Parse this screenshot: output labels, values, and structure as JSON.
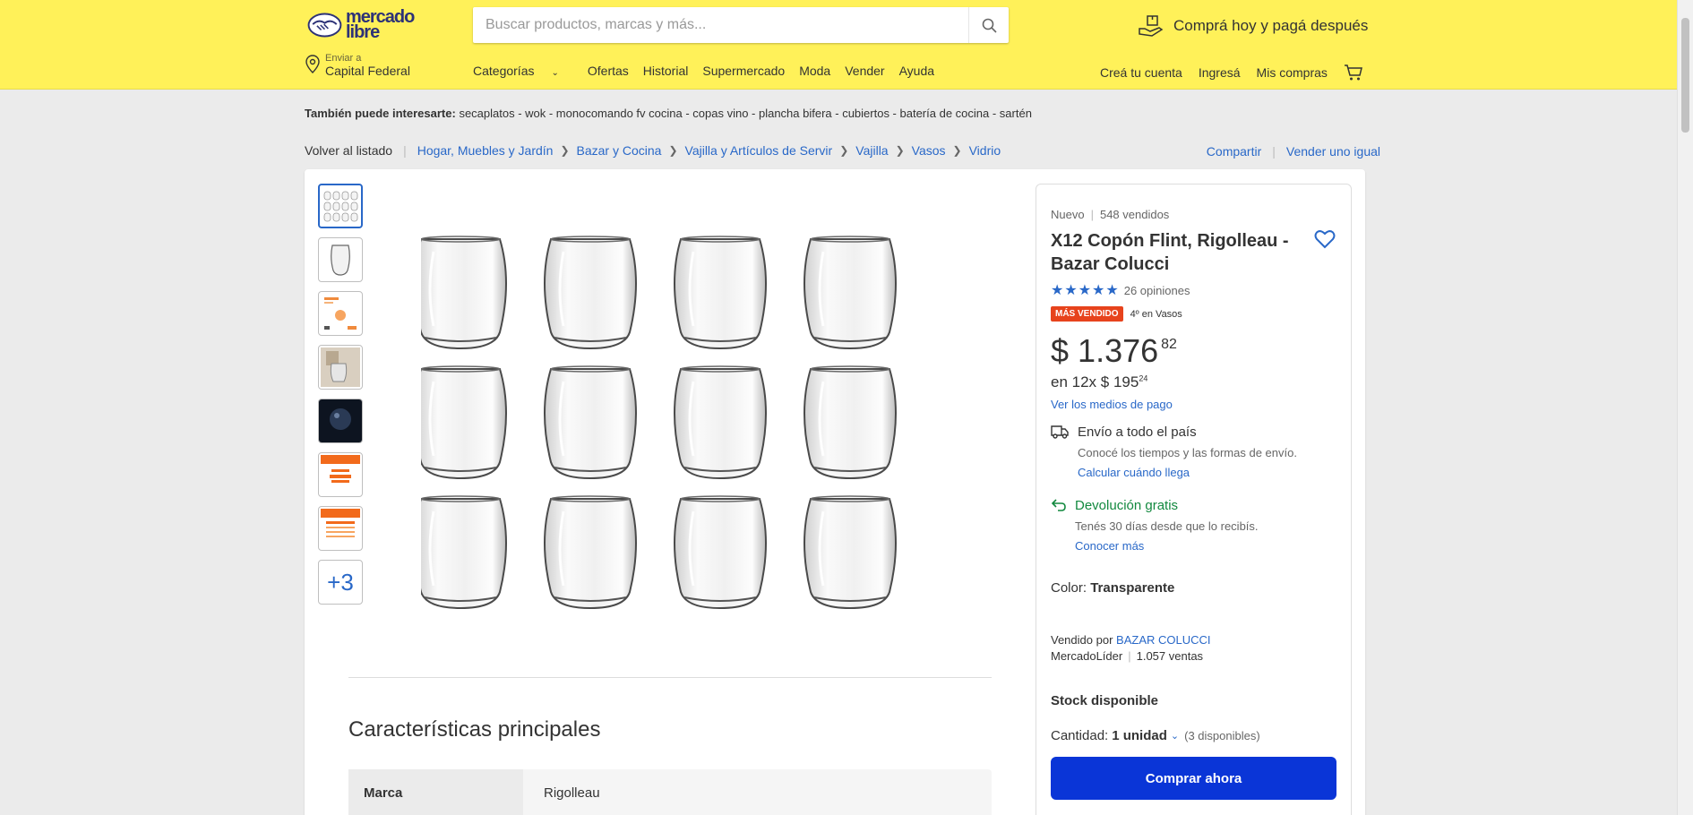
{
  "header": {
    "logo_text": "mercado libre",
    "search_placeholder": "Buscar productos, marcas y más...",
    "promo": "Comprá hoy y pagá después",
    "location_label": "Enviar a",
    "location_value": "Capital Federal",
    "nav": [
      "Categorías",
      "Ofertas",
      "Historial",
      "Supermercado",
      "Moda",
      "Vender",
      "Ayuda"
    ],
    "account": [
      "Creá tu cuenta",
      "Ingresá",
      "Mis compras"
    ]
  },
  "interest": {
    "label": "También puede interesarte:",
    "items": "secaplatos - wok - monocomando fv cocina - copas vino - plancha bifera - cubiertos - batería de cocina - sartén"
  },
  "breadcrumb": {
    "back": "Volver al listado",
    "items": [
      "Hogar, Muebles y Jardín",
      "Bazar y Cocina",
      "Vajilla y Artículos de Servir",
      "Vajilla",
      "Vasos",
      "Vidrio"
    ]
  },
  "share": {
    "share": "Compartir",
    "sell": "Vender uno igual"
  },
  "gallery": {
    "more": "+3"
  },
  "features": {
    "title": "Características principales",
    "rows": [
      {
        "key": "Marca",
        "value": "Rigolleau"
      }
    ]
  },
  "product": {
    "condition": "Nuevo",
    "sold": "548 vendidos",
    "title": "X12 Copón Flint, Rigolleau - Bazar Colucci",
    "reviews": "26 opiniones",
    "badge": "MÁS VENDIDO",
    "rank": "4º en Vasos",
    "price_currency": "$",
    "price_int": "1.376",
    "price_cents": "82",
    "installments_prefix": "en 12x $ 195",
    "installments_cents": "24",
    "payment_link": "Ver los medios de pago",
    "shipping_title": "Envío a todo el país",
    "shipping_sub": "Conocé los tiempos y las formas de envío.",
    "shipping_link": "Calcular cuándo llega",
    "return_title": "Devolución gratis",
    "return_sub": "Tenés 30 días desde que lo recibís.",
    "return_link": "Conocer más",
    "color_label": "Color:",
    "color_value": "Transparente",
    "sold_by_label": "Vendido por",
    "seller": "BAZAR COLUCCI",
    "seller_level": "MercadoLíder",
    "seller_sales": "1.057 ventas",
    "stock": "Stock disponible",
    "qty_label": "Cantidad:",
    "qty_value": "1 unidad",
    "qty_available": "(3 disponibles)",
    "buy_label": "Comprar ahora"
  },
  "colors": {
    "header_bg": "#fff159",
    "link": "#2968c8",
    "primary_button": "#0a35d7",
    "badge": "#e7431c",
    "success": "#12893f"
  }
}
